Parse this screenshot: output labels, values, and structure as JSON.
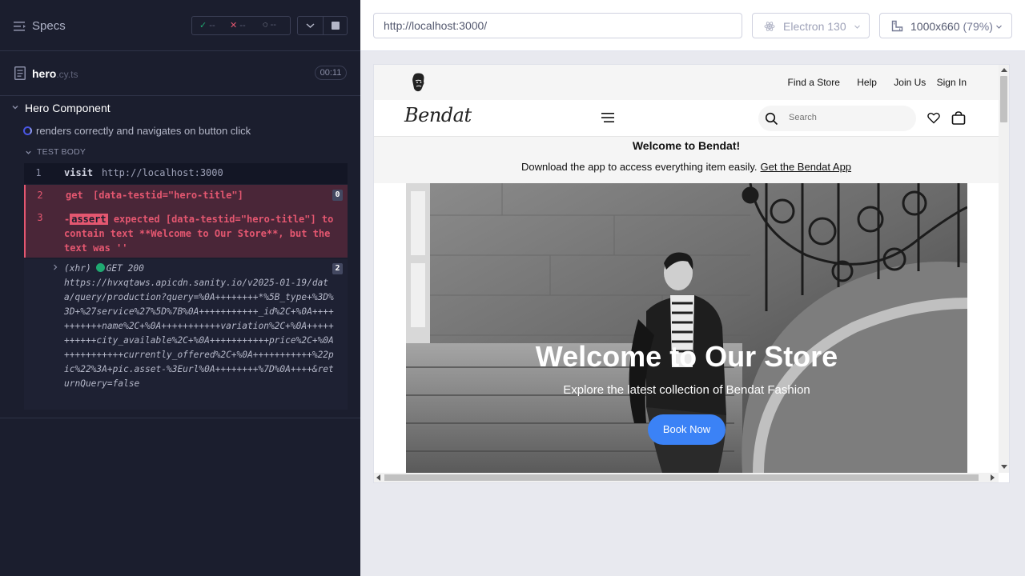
{
  "reporter": {
    "specs_label": "Specs",
    "stats": {
      "passed_icon": "check-icon",
      "passed": "--",
      "failed_icon": "x-icon",
      "failed": "--",
      "pending_icon": "spinner-icon",
      "pending": "--"
    },
    "spec": {
      "name": "hero",
      "ext": ".cy.ts",
      "duration": "00:11"
    },
    "suite": {
      "title": "Hero Component"
    },
    "test": {
      "title": "renders correctly and navigates on button click"
    },
    "body_label": "TEST BODY",
    "commands": {
      "visit": {
        "num": "1",
        "name": "visit",
        "message": "http://localhost:3000"
      },
      "get": {
        "num": "2",
        "name": "get",
        "selector": "[data-testid=\"hero-title\"]",
        "count": "0"
      },
      "assert": {
        "num": "3",
        "dash": "-",
        "tag": "assert",
        "text": " expected [data-testid=\"hero-title\"] to contain text **Welcome to Our Store**, but the text was ''"
      },
      "xhr": {
        "label": "(xhr)",
        "status": "GET 200",
        "url": "https://hvxqtaws.apicdn.sanity.io/v2025-01-19/data/query/production?query=%0A++++++++*%5B_type+%3D%3D+%27service%27%5D%7B%0A+++++++++++_id%2C+%0A+++++++++++name%2C+%0A+++++++++++variation%2C+%0A+++++++++++city_available%2C+%0A+++++++++++price%2C+%0A+++++++++++currently_offered%2C+%0A+++++++++++%22pic%22%3A+pic.asset-%3Eurl%0A++++++++%7D%0A++++&returnQuery=false",
        "count": "2"
      }
    }
  },
  "toolbar": {
    "url": "http://localhost:3000/",
    "browser": "Electron 130",
    "viewport": "1000x660",
    "scale": "(79%)"
  },
  "site": {
    "util_links": [
      "Find a Store",
      "Help",
      "Join Us",
      "Sign In"
    ],
    "brand": "Bendat",
    "search_placeholder": "Search",
    "promo_title": "Welcome to Bendat!",
    "promo_text": "Download the app to access everything item easily.",
    "promo_link": "Get the Bendat App",
    "hero_title": "Welcome to Our Store",
    "hero_subtitle": "Explore the latest collection of Bendat Fashion",
    "hero_button": "Book Now"
  },
  "colors": {
    "reporter_bg": "#1b1e2e",
    "fail": "#e45770",
    "pass": "#1fa971",
    "accent": "#3b82f6"
  }
}
